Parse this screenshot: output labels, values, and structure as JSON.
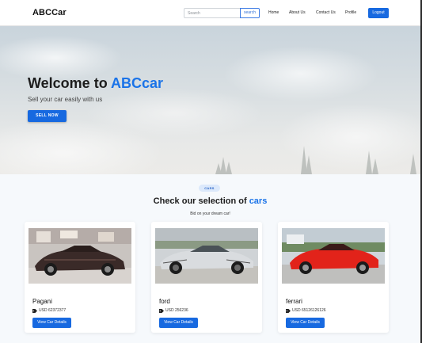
{
  "app": {
    "brand": "ABCCar"
  },
  "navbar": {
    "search_placeholder": "Search",
    "search_button": "search",
    "links": [
      "Home",
      "About Us",
      "Contact Us",
      "Profile"
    ],
    "logout": "Logout"
  },
  "hero": {
    "title_prefix": "Welcome to ",
    "title_accent": "ABCcar",
    "subtitle": "Sell your car easily with us",
    "cta": "SELL NOW"
  },
  "section": {
    "badge": "CARS",
    "title_prefix": "Check our selection of ",
    "title_accent": "cars",
    "subtitle": "Bid on your dream car!"
  },
  "cars": [
    {
      "name": "Pagani",
      "price": "USD 62372377",
      "button": "View Car Details",
      "color": "#3a2a28"
    },
    {
      "name": "ford",
      "price": "USD 256236",
      "button": "View Car Details",
      "color": "#d9dcdf"
    },
    {
      "name": "ferrari",
      "price": "USD 65126126126",
      "button": "View Car Details",
      "color": "#e2231a"
    }
  ],
  "colors": {
    "primary": "#1769e0",
    "accent_text": "#1a73e8",
    "badge_bg": "#dce9fb"
  }
}
